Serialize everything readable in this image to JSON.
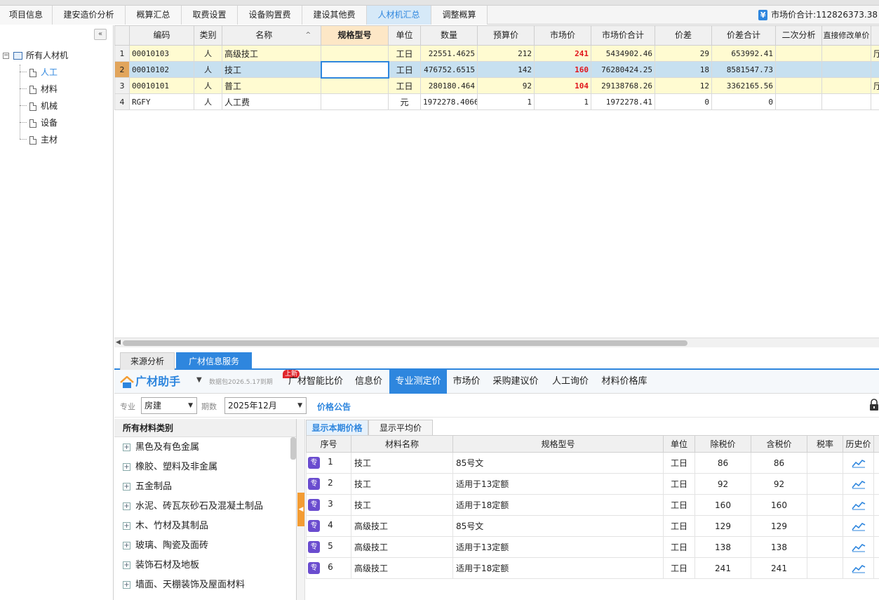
{
  "tabs": [
    "项目信息",
    "建安造价分析",
    "概算汇总",
    "取费设置",
    "设备购置费",
    "建设其他费",
    "人材机汇总",
    "调整概算"
  ],
  "active_tab": "人材机汇总",
  "market_total_label": "市场价合计:112826373.38",
  "tree": {
    "root": "所有人材机",
    "children": [
      "人工",
      "材料",
      "机械",
      "设备",
      "主材"
    ],
    "selected": "人工"
  },
  "grid": {
    "headers": [
      "编码",
      "类别",
      "名称",
      "规格型号",
      "单位",
      "数量",
      "预算价",
      "市场价",
      "市场价合计",
      "价差",
      "价差合计",
      "二次分析",
      "直接修改单价"
    ],
    "rows": [
      {
        "no": "1",
        "code": "00010103",
        "type": "人",
        "name": "高级技工",
        "spec": "",
        "unit": "工日",
        "qty": "22551.4625",
        "budget": "212",
        "market": "241",
        "market_total": "5434902.46",
        "diff": "29",
        "diff_total": "653992.41",
        "extra": "厅"
      },
      {
        "no": "2",
        "code": "00010102",
        "type": "人",
        "name": "技工",
        "spec": "",
        "unit": "工日",
        "qty": "476752.6515",
        "budget": "142",
        "market": "160",
        "market_total": "76280424.25",
        "diff": "18",
        "diff_total": "8581547.73",
        "extra": ""
      },
      {
        "no": "3",
        "code": "00010101",
        "type": "人",
        "name": "普工",
        "spec": "",
        "unit": "工日",
        "qty": "280180.464",
        "budget": "92",
        "market": "104",
        "market_total": "29138768.26",
        "diff": "12",
        "diff_total": "3362165.56",
        "extra": "厅"
      },
      {
        "no": "4",
        "code": "RGFY",
        "type": "人",
        "name": "人工费",
        "spec": "",
        "unit": "元",
        "qty": "1972278.4066",
        "budget": "1",
        "market": "1",
        "market_total": "1972278.41",
        "diff": "0",
        "diff_total": "0",
        "extra": ""
      }
    ]
  },
  "bottom_tabs": [
    "来源分析",
    "广材信息服务"
  ],
  "gc": {
    "logo": "广材助手",
    "data_label": "数据包2026.5.17到期",
    "new_badge": "上新",
    "nav": [
      "广材智能比价",
      "信息价",
      "专业测定价",
      "市场价",
      "采购建议价",
      "人工询价",
      "材料价格库"
    ],
    "active_nav": "专业测定价"
  },
  "filter": {
    "major_label": "专业",
    "major_value": "房建",
    "period_label": "期数",
    "period_value": "2025年12月",
    "notice": "价格公告"
  },
  "categories": {
    "title": "所有材料类别",
    "items": [
      "黑色及有色金属",
      "橡胶、塑料及非金属",
      "五金制品",
      "水泥、砖瓦灰砂石及混凝土制品",
      "木、竹材及其制品",
      "玻璃、陶瓷及面砖",
      "装饰石材及地板",
      "墙面、天棚装饰及屋面材料"
    ]
  },
  "price_tabs": [
    "显示本期价格",
    "显示平均价"
  ],
  "price_table": {
    "headers": [
      "序号",
      "材料名称",
      "规格型号",
      "单位",
      "除税价",
      "含税价",
      "税率",
      "历史价"
    ],
    "badge": "专",
    "rows": [
      {
        "no": "1",
        "name": "技工",
        "spec": "85号文",
        "unit": "工日",
        "ex_tax": "86",
        "in_tax": "86",
        "rate": ""
      },
      {
        "no": "2",
        "name": "技工",
        "spec": "适用于13定额",
        "unit": "工日",
        "ex_tax": "92",
        "in_tax": "92",
        "rate": ""
      },
      {
        "no": "3",
        "name": "技工",
        "spec": "适用于18定额",
        "unit": "工日",
        "ex_tax": "160",
        "in_tax": "160",
        "rate": ""
      },
      {
        "no": "4",
        "name": "高级技工",
        "spec": "85号文",
        "unit": "工日",
        "ex_tax": "129",
        "in_tax": "129",
        "rate": ""
      },
      {
        "no": "5",
        "name": "高级技工",
        "spec": "适用于13定额",
        "unit": "工日",
        "ex_tax": "138",
        "in_tax": "138",
        "rate": ""
      },
      {
        "no": "6",
        "name": "高级技工",
        "spec": "适用于18定额",
        "unit": "工日",
        "ex_tax": "241",
        "in_tax": "241",
        "rate": ""
      }
    ]
  },
  "colors": {
    "accent": "#2e86de",
    "highlight_red": "#e0161b",
    "row_yellow": "#fffbd1",
    "row_selected": "#c7e0f0",
    "spec_header": "#fde7c6"
  }
}
